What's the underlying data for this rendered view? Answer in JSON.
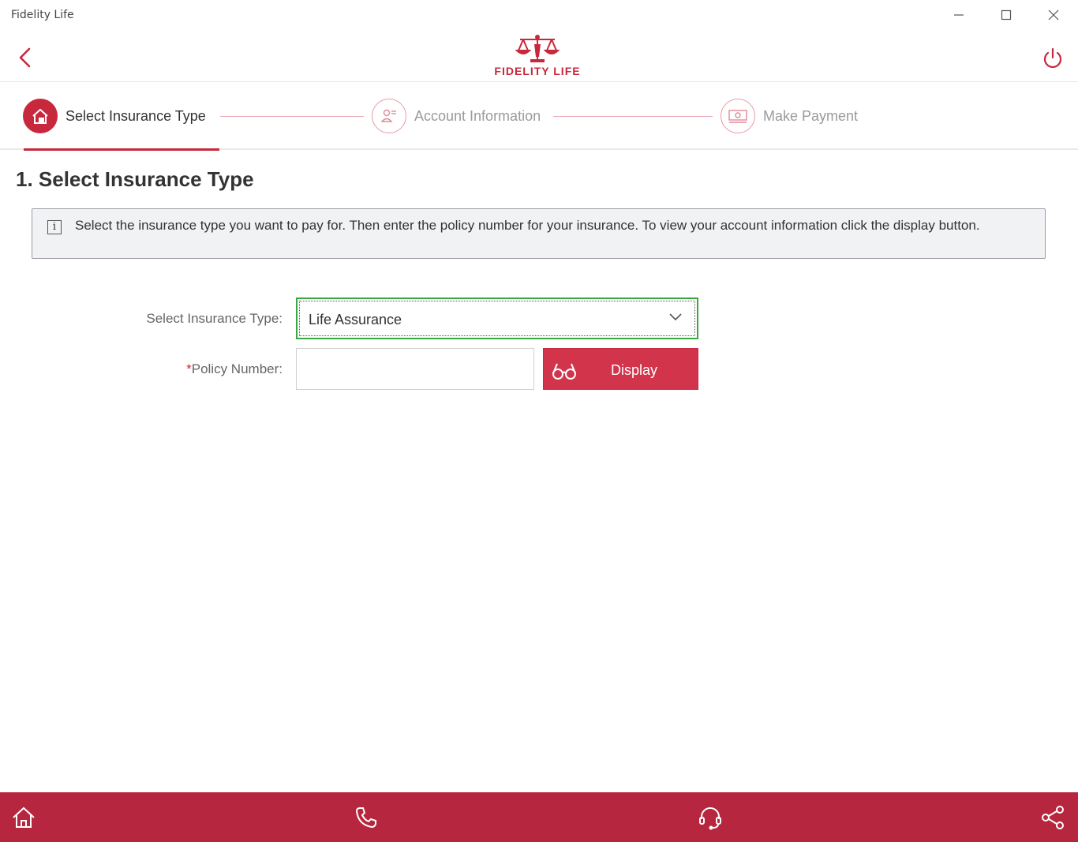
{
  "window": {
    "title": "Fidelity Life"
  },
  "header": {
    "logo_text": "FIDELITY LIFE"
  },
  "stepper": {
    "steps": [
      {
        "label": "Select Insurance Type",
        "icon": "insurance-house-icon",
        "active": true
      },
      {
        "label": "Account Information",
        "icon": "account-card-icon",
        "active": false
      },
      {
        "label": "Make Payment",
        "icon": "payment-money-icon",
        "active": false
      }
    ]
  },
  "main": {
    "title": "1. Select Insurance Type",
    "info": "Select the insurance type you want to pay for. Then enter the policy number for your insurance. To view your account information click the display button.",
    "form": {
      "insurance_type_label": "Select Insurance Type:",
      "insurance_type_value": "Life Assurance",
      "policy_required_mark": "*",
      "policy_label": "Policy Number:",
      "policy_value": "",
      "display_label": "Display"
    }
  },
  "bottom_bar": {
    "icons": [
      "home-icon",
      "phone-icon",
      "headset-icon",
      "share-icon"
    ]
  },
  "colors": {
    "brand": "#c8283c",
    "bottom_bar": "#b7263f",
    "button": "#d2344c",
    "focus": "#39a83e"
  }
}
